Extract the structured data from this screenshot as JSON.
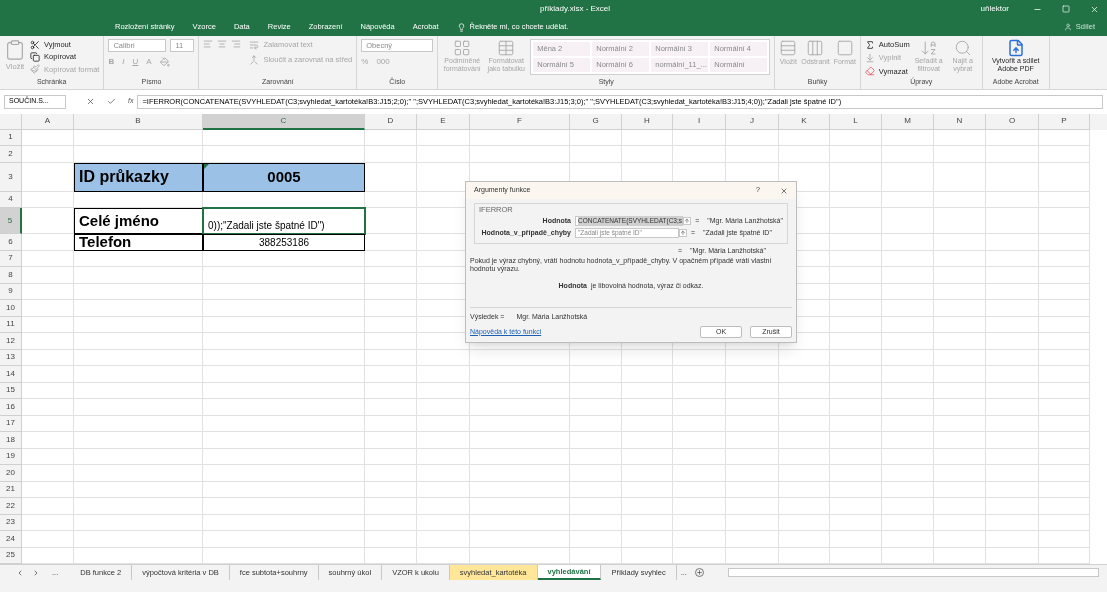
{
  "title_bar": {
    "title": "příklady.xlsx - Excel",
    "user": "uňlektor",
    "share": "Sdílet"
  },
  "tabs": [
    {
      "label": "Rozložení stránky"
    },
    {
      "label": "Vzorce"
    },
    {
      "label": "Data"
    },
    {
      "label": "Revize"
    },
    {
      "label": "Zobrazení"
    },
    {
      "label": "Nápověda"
    },
    {
      "label": "Acrobat"
    }
  ],
  "tell_me": "Řekněte mi, co chcete udělat.",
  "ribbon": [
    {
      "kind": "clipboard",
      "label": "Schránka",
      "items": [
        {
          "label": "Vložit",
          "disabled": true
        },
        {
          "label": "Vyjmout",
          "disabled": false
        },
        {
          "label": "Kopírovat",
          "disabled": false
        },
        {
          "label": "Kopírovat formát",
          "disabled": true
        }
      ]
    },
    {
      "kind": "font",
      "label": "Písmo",
      "font": "Calibri",
      "size": "11",
      "items": [
        {
          "label": "B",
          "disabled": true
        },
        {
          "label": "I",
          "disabled": true
        },
        {
          "label": "U",
          "disabled": true
        },
        {
          "label": "A",
          "disabled": true
        }
      ]
    },
    {
      "kind": "alignment",
      "label": "Zarovnání",
      "items": [
        {
          "label": "Zalamovat text",
          "disabled": true
        },
        {
          "label": "Sloučit a zarovnat na střed",
          "disabled": true
        }
      ]
    },
    {
      "kind": "number",
      "label": "Číslo",
      "format": "Obecný",
      "items": [
        {
          "label": "%",
          "disabled": true
        },
        {
          "label": "000",
          "disabled": true
        }
      ]
    },
    {
      "kind": "styles",
      "label": "Styly",
      "items": [
        {
          "label": "Podmíněné formátování",
          "disabled": true
        },
        {
          "label": "Formátovat jako tabulku",
          "disabled": true
        }
      ],
      "gallery": [
        "Měna 2",
        "Normální 2",
        "Normální 3",
        "Normální 4",
        "Normální 5",
        "Normální 6",
        "normální_11_...",
        "Normální"
      ]
    },
    {
      "kind": "cells",
      "label": "Buňky",
      "items": [
        {
          "label": "Vložit",
          "disabled": true
        },
        {
          "label": "Odstranit",
          "disabled": true
        },
        {
          "label": "Formát",
          "disabled": true
        }
      ]
    },
    {
      "kind": "editing",
      "label": "Úpravy",
      "items": [
        {
          "label": "AutoSum",
          "disabled": false
        },
        {
          "label": "Vyplnit",
          "disabled": true
        },
        {
          "label": "Vymazat",
          "disabled": false
        },
        {
          "label": "Seřadit a filtrovat",
          "disabled": true
        },
        {
          "label": "Najít a vybrat",
          "disabled": true
        }
      ]
    },
    {
      "kind": "acrobat",
      "label": "Adobe Acrobat",
      "items": [
        {
          "label": "Vytvořit a sdílet Adobe PDF",
          "disabled": false
        }
      ]
    }
  ],
  "formula_bar": {
    "name_box": "SOUČIN.S...",
    "fx": "fx",
    "formula": "=IFERROR(CONCATENATE(SVYHLEDAT(C3;svyhledat_kartotéka!B3:J15;2;0);\" \";SVYHLEDAT(C3;svyhledat_kartotéka!B3:J15;3;0);\" \";SVYHLEDAT(C3;svyhledat_kartotéka!B3:J15;4;0));\"Zadali jste špatné ID\")"
  },
  "columns": [
    {
      "label": "A",
      "selected": false
    },
    {
      "label": "B",
      "selected": false
    },
    {
      "label": "C",
      "selected": true
    },
    {
      "label": "D",
      "selected": false
    },
    {
      "label": "E",
      "selected": false
    },
    {
      "label": "F",
      "selected": false
    },
    {
      "label": "G",
      "selected": false
    },
    {
      "label": "H",
      "selected": false
    },
    {
      "label": "I",
      "selected": false
    },
    {
      "label": "J",
      "selected": false
    },
    {
      "label": "K",
      "selected": false
    },
    {
      "label": "L",
      "selected": false
    },
    {
      "label": "M",
      "selected": false
    },
    {
      "label": "N",
      "selected": false
    },
    {
      "label": "O",
      "selected": false
    },
    {
      "label": "P",
      "selected": false
    }
  ],
  "rows": [
    {
      "label": "1",
      "selected": false
    },
    {
      "label": "2",
      "selected": false
    },
    {
      "label": "3",
      "selected": false,
      "column_b": {
        "kind": "heading",
        "text": "ID průkazky",
        "selected": false
      },
      "column_c": {
        "kind": "heading_value",
        "text": "0005",
        "selected": false
      }
    },
    {
      "label": "4",
      "selected": false
    },
    {
      "label": "5",
      "selected": true,
      "column_b": {
        "kind": "label",
        "text": "Celé jméno",
        "selected": false
      },
      "column_c": {
        "kind": "formula",
        "text": "0));\"Zadali jste špatné ID\")",
        "selected": true
      }
    },
    {
      "label": "6",
      "selected": false,
      "column_b": {
        "kind": "label",
        "text": "Telefon",
        "selected": false
      },
      "column_c": {
        "kind": "value",
        "text": "388253186",
        "selected": false
      }
    },
    {
      "label": "7",
      "selected": false
    },
    {
      "label": "8",
      "selected": false
    },
    {
      "label": "9",
      "selected": false
    },
    {
      "label": "10",
      "selected": false
    },
    {
      "label": "11",
      "selected": false
    },
    {
      "label": "12",
      "selected": false
    },
    {
      "label": "13",
      "selected": false
    },
    {
      "label": "14",
      "selected": false
    },
    {
      "label": "15",
      "selected": false
    },
    {
      "label": "16",
      "selected": false
    },
    {
      "label": "17",
      "selected": false
    },
    {
      "label": "18",
      "selected": false
    },
    {
      "label": "19",
      "selected": false
    },
    {
      "label": "20",
      "selected": false
    },
    {
      "label": "21",
      "selected": false
    },
    {
      "label": "22",
      "selected": false
    },
    {
      "label": "23",
      "selected": false
    },
    {
      "label": "24",
      "selected": false
    },
    {
      "label": "25",
      "selected": false
    }
  ],
  "sheet_tabs": {
    "more_left": "...",
    "more_right": "...",
    "tabs": [
      {
        "label": "DB funkce 2",
        "selected": false,
        "color": "#f3f3f3"
      },
      {
        "label": "výpočtová kritéria v DB",
        "selected": false,
        "color": "#f3f3f3"
      },
      {
        "label": "fce subtota+souhrny",
        "selected": false,
        "color": "#f3f3f3"
      },
      {
        "label": "souhrný úkol",
        "selected": false,
        "color": "#f3f3f3"
      },
      {
        "label": "VZOR k ukolu",
        "selected": false,
        "color": "#f3f3f3"
      },
      {
        "label": "svyhledat_kartotéka",
        "selected": false,
        "color": "#ffe699"
      },
      {
        "label": "vyhledávání",
        "selected": true,
        "color": "#ffffff"
      },
      {
        "label": "Příklady svyhlec",
        "selected": false,
        "color": "#f3f3f3"
      }
    ]
  },
  "dialog": {
    "title": "Argumenty funkce",
    "help": "?",
    "function_name": "IFERROR",
    "arguments": [
      {
        "label": "Hodnota",
        "value": "CONCATENATE(SVYHLEDAT(C3;s",
        "selected": true,
        "eq": "=",
        "result": "\"Mgr. Mária Lanžhotská\""
      },
      {
        "label": "Hodnota_v_případě_chyby",
        "value": "\"Zadali jste špatné ID\"",
        "selected": false,
        "eq": "=",
        "result": "\"Zadali jste špatné ID\""
      }
    ],
    "overall_eq": "=",
    "overall_result": "\"Mgr. Mária Lanžhotská\"",
    "description": "Pokud je výraz chybný, vrátí hodnotu hodnota_v_případě_chyby. V opačném případě vrátí vlastní hodnotu výrazu.",
    "arg_help_name": "Hodnota",
    "arg_help": "je libovolná hodnota, výraz či odkaz.",
    "result_label": "Výsledek =",
    "result_value": "Mgr. Mária Lanžhotská",
    "help_link": "Nápověda k této funkci",
    "buttons": [
      "OK",
      "Zrušit"
    ]
  }
}
